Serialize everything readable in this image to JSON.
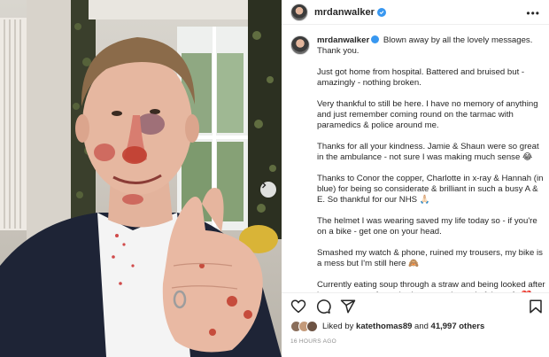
{
  "header": {
    "username": "mrdanwalker"
  },
  "caption": {
    "username": "mrdanwalker",
    "paragraphs": [
      "Blown away by all the lovely messages. Thank you.",
      "Just got home from hospital. Battered and bruised but - amazingly - nothing broken.",
      "Very thankful to still be here. I have no memory of anything and just remember coming round on the tarmac with paramedics & police around me.",
      "Thanks for all your kindness. Jamie & Shaun were so great in the ambulance - not sure I was making much sense 😂",
      "Thanks to Conor the copper, Charlotte in x-ray & Hannah (in blue) for being so considerate & brilliant in such a busy A & E. So thankful for our NHS 🙏🏻",
      "The helmet I was wearing saved my life today so - if you're on a bike - get one on your head.",
      "Smashed my watch & phone, ruined my trousers, my bike is a mess but I'm still here 🙈",
      "Currently eating soup through a straw and being looked after by a gorgeous, furry, tired nurse at the end of the sofa ❤️"
    ]
  },
  "likes": {
    "prefix": "Liked by ",
    "first_liker": "katethomas89",
    "middle": " and ",
    "others": "41,997 others"
  },
  "timestamp": "16 HOURS AGO",
  "icons": {
    "more": "more-options-icon",
    "like": "heart-icon",
    "comment": "comment-icon",
    "share": "share-icon",
    "save": "bookmark-icon",
    "next": "chevron-right-icon"
  },
  "colors": {
    "verified": "#3897f0",
    "text": "#262626",
    "muted": "#8e8e8e",
    "border": "#efefef"
  }
}
